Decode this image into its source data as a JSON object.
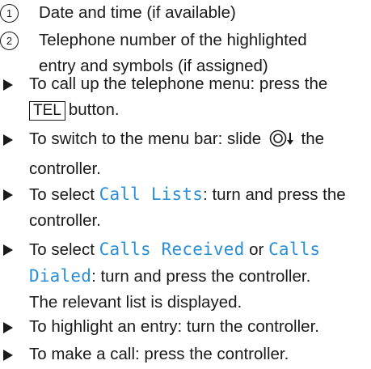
{
  "legend": [
    {
      "number": "1",
      "text": "Date and time (if available)"
    },
    {
      "number": "2",
      "line1": "Telephone number of the highlighted",
      "line2": "entry and symbols (if assigned)"
    }
  ],
  "steps": {
    "s1": {
      "prefix": "To call up the telephone menu: press the",
      "key": "TEL",
      "suffix": "button."
    },
    "s2": {
      "prefix": "To switch to the menu bar: slide",
      "suffix": "the",
      "line2": "controller."
    },
    "s3": {
      "prefix": "To select",
      "term": "Call Lists",
      "suffix": ": turn and press the",
      "line2": "controller."
    },
    "s4": {
      "prefix": "To select",
      "term1": "Calls Received",
      "mid": "or",
      "term2a": "Calls",
      "term2b": "Dialed",
      "suffix": ": turn and press the controller.",
      "line3": "The relevant list is displayed."
    },
    "s5": {
      "text": "To highlight an entry: turn the controller."
    },
    "s6": {
      "text": "To make a call: press the controller."
    }
  },
  "colors": {
    "highlight": "#2a8fd6",
    "text": "#1a1a1a"
  },
  "icons": {
    "bullet": "triangle-bullet-icon",
    "controller": "controller-slide-down-icon"
  }
}
